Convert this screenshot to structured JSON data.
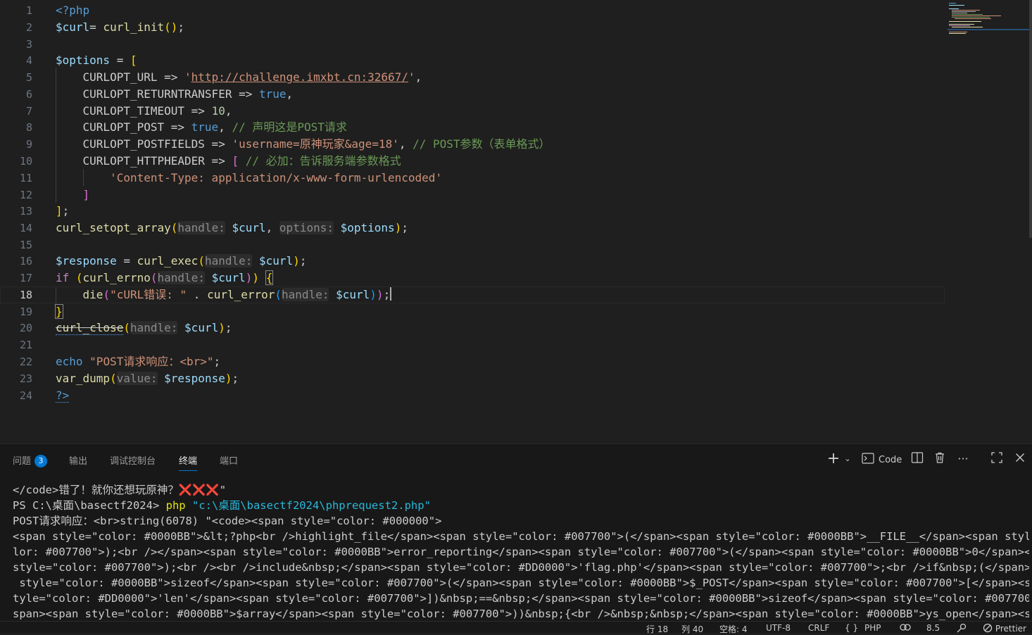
{
  "editor": {
    "lines": [
      {
        "n": "1"
      },
      {
        "n": "2"
      },
      {
        "n": "3"
      },
      {
        "n": "4"
      },
      {
        "n": "5"
      },
      {
        "n": "6"
      },
      {
        "n": "7"
      },
      {
        "n": "8"
      },
      {
        "n": "9"
      },
      {
        "n": "10"
      },
      {
        "n": "11"
      },
      {
        "n": "12"
      },
      {
        "n": "13"
      },
      {
        "n": "14"
      },
      {
        "n": "15"
      },
      {
        "n": "16"
      },
      {
        "n": "17"
      },
      {
        "n": "18"
      },
      {
        "n": "19"
      },
      {
        "n": "20"
      },
      {
        "n": "21"
      },
      {
        "n": "22"
      },
      {
        "n": "23"
      },
      {
        "n": "24"
      }
    ],
    "t": {
      "php_open": "<?php",
      "curl_var": "$curl",
      "assign": "= ",
      "curl_init": "curl_init",
      "options_var": "$options",
      "eq": " = ",
      "c_url": "CURLOPT_URL",
      "arrow": " => ",
      "url_q": "'",
      "url": "http://challenge.imxbt.cn:32667/",
      "c_rt": "CURLOPT_RETURNTRANSFER",
      "true": "true",
      "c_to": "CURLOPT_TIMEOUT",
      "ten": "10",
      "c_post": "CURLOPT_POST",
      "cmt_post": "// 声明这是POST请求",
      "c_pf": "CURLOPT_POSTFIELDS",
      "pf_str": "'username=原神玩家&age=18'",
      "cmt_pf": "// POST参数（表单格式）",
      "c_hh": "CURLOPT_HTTPHEADER",
      "cmt_hh": "// 必加：告诉服务端参数格式",
      "ct_str": "'Content-Type: application/x-www-form-urlencoded'",
      "setopt": "curl_setopt_array",
      "h_handle": "handle:",
      "h_options": "options:",
      "h_value": "value:",
      "response_var": "$response",
      "exec": "curl_exec",
      "if": "if",
      "errno": "curl_errno",
      "die": "die",
      "err_str": "\"cURL错误: \"",
      "dot": " . ",
      "curl_error": "curl_error",
      "close": "curl_close",
      "echo": "echo",
      "echo_str": "\"POST请求响应：<br>\"",
      "var_dump": "var_dump",
      "php_close": "?>"
    }
  },
  "panel": {
    "tabs": [
      {
        "label": "问题",
        "badge": "3"
      },
      {
        "label": "输出"
      },
      {
        "label": "调试控制台"
      },
      {
        "label": "终端"
      },
      {
        "label": "端口"
      }
    ],
    "terminal_profile": "Code",
    "terminal": {
      "l1_text": "</code>错了！就你还想玩原神？",
      "l1_marks": "❌❌❌",
      "l1_end": "\"",
      "prompt": "PS C:\\桌面\\basectf2024> ",
      "cmd": "php",
      "cmd_arg": " \"c:\\桌面\\basectf2024\\phprequest2.php\"",
      "out": [
        "POST请求响应：<br>string(6078) \"<code><span style=\"color: #000000\">",
        "<span style=\"color: #0000BB\">&lt;?php<br />highlight_file</span><span style=\"color: #007700\">(</span><span style=\"color: #0000BB\">__FILE__</span><span style=\"co",
        "lor: #007700\">);<br /></span><span style=\"color: #0000BB\">error_reporting</span><span style=\"color: #007700\">(</span><span style=\"color: #0000BB\">0</span><span ",
        "style=\"color: #007700\">);<br /><br />include&nbsp;</span><span style=\"color: #DD0000\">'flag.php'</span><span style=\"color: #007700\">;<br />if&nbsp;(</span><span",
        " style=\"color: #0000BB\">sizeof</span><span style=\"color: #007700\">(</span><span style=\"color: #0000BB\">$_POST</span><span style=\"color: #007700\">[</span><span s",
        "tyle=\"color: #DD0000\">'len'</span><span style=\"color: #007700\">])&nbsp;==&nbsp;</span><span style=\"color: #0000BB\">sizeof</span><span style=\"color: #007700\">(</",
        "span><span style=\"color: #0000BB\">$array</span><span style=\"color: #007700\">))&nbsp;{<br />&nbsp;&nbsp;</span><span style=\"color: #0000BB\">ys_open</span><span s"
      ]
    }
  },
  "status": {
    "row": "行 18",
    "col": "列 40",
    "spaces": "空格: 4",
    "encoding": "UTF-8",
    "eol": "CRLF",
    "lang_icon": "{ }",
    "lang": "PHP",
    "version": "8.5",
    "prettier": "Prettier"
  },
  "colors": {
    "accent": "#0078d4",
    "bg_editor": "#1f1f1f",
    "bg_panel": "#181818"
  }
}
